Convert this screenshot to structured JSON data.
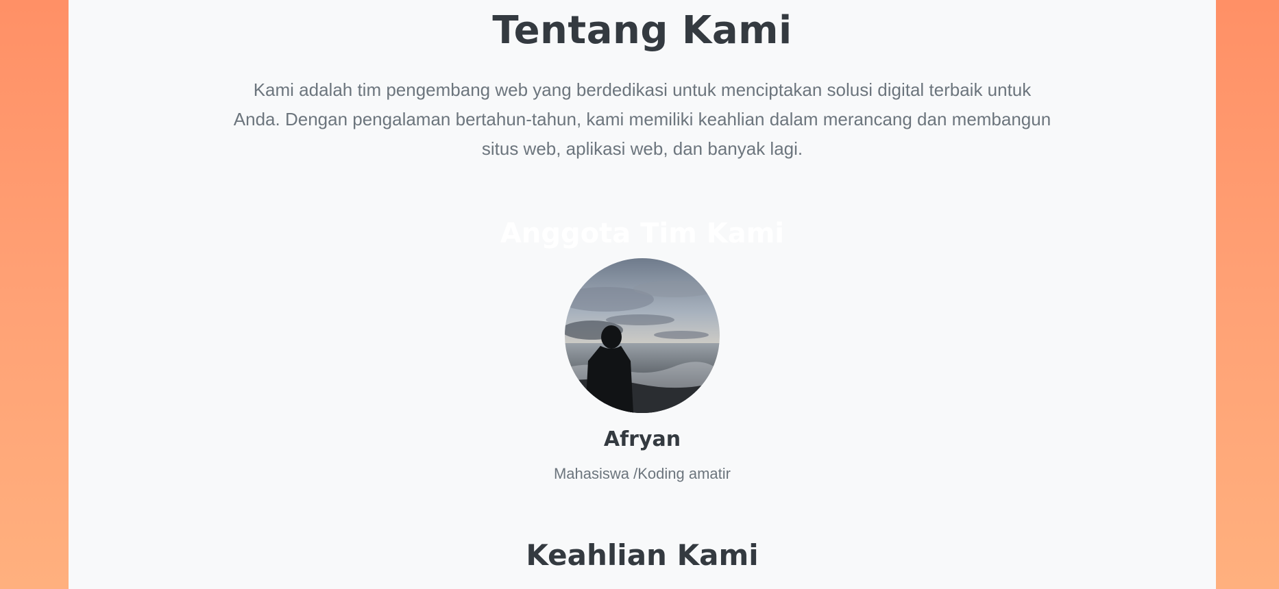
{
  "about": {
    "title": "Tentang Kami",
    "description": "Kami adalah tim pengembang web yang berdedikasi untuk menciptakan solusi digital terbaik untuk Anda. Dengan pengalaman bertahun-tahun, kami memiliki keahlian dalam merancang dan membangun situs web, aplikasi web, dan banyak lagi."
  },
  "team": {
    "heading": "Anggota Tim Kami",
    "members": [
      {
        "name": "Afryan",
        "role": "Mahasiswa /Koding amatir",
        "photo_icon": "person-at-beach-photo"
      }
    ]
  },
  "skills": {
    "heading": "Keahlian Kami"
  },
  "colors": {
    "background_gradient_top": "#ff9066",
    "background_gradient_bottom": "#ffb07e",
    "panel": "#f8f9fa",
    "heading_text": "#343a40",
    "muted_text": "#6c757d"
  }
}
